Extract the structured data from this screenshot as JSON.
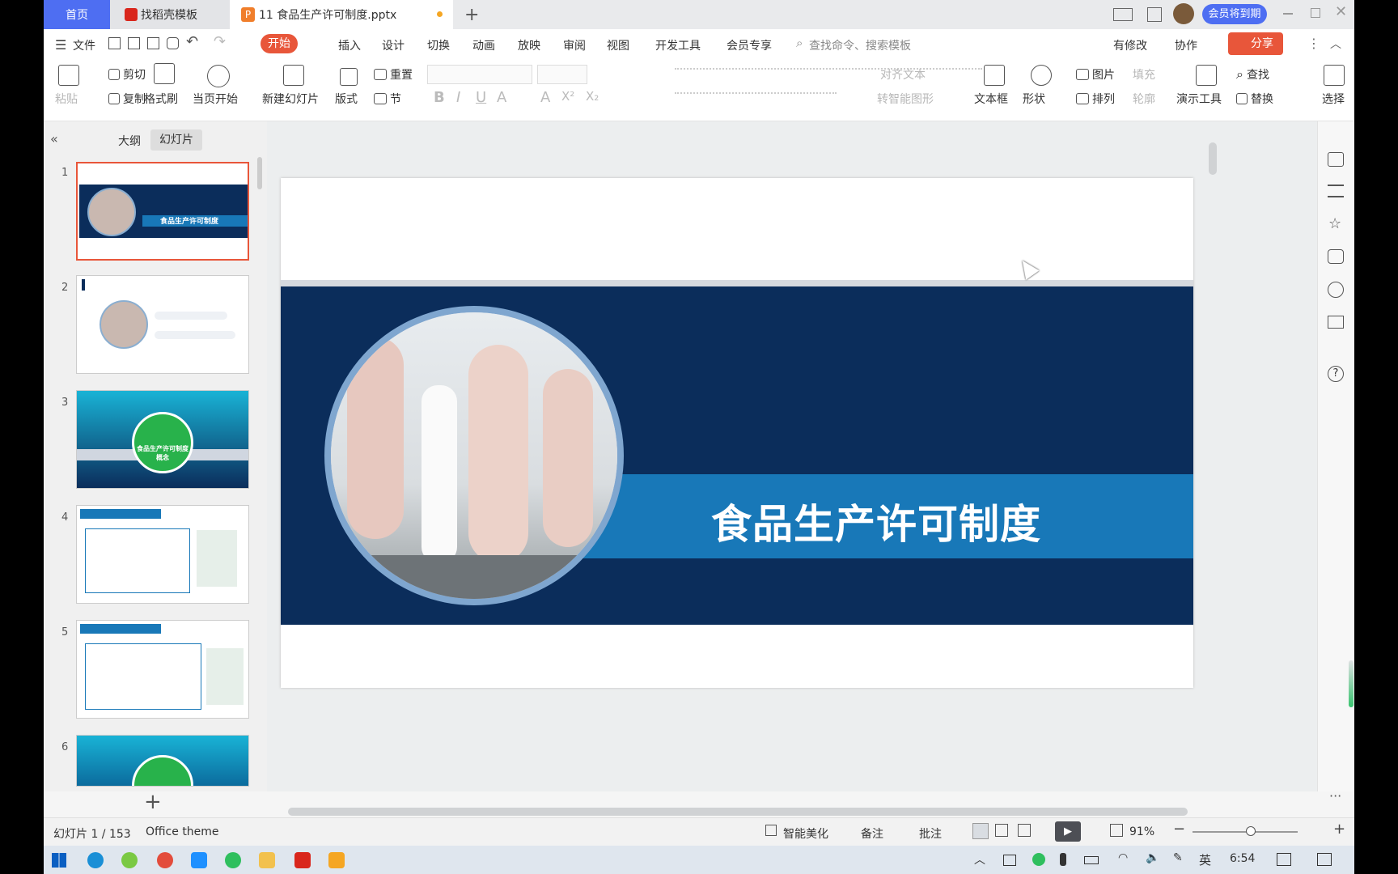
{
  "tabs": {
    "home": "首页",
    "template": "找稻壳模板",
    "doc": "11 食品生产许可制度.pptx",
    "member": "会员将到期"
  },
  "menu": {
    "file": "文件",
    "items": [
      "开始",
      "插入",
      "设计",
      "切换",
      "动画",
      "放映",
      "审阅",
      "视图",
      "开发工具",
      "会员专享"
    ],
    "search": "查找命令、搜索模板",
    "modified": "有修改",
    "collab": "协作",
    "share": "分享"
  },
  "ribbon": {
    "paste": "粘贴",
    "cut": "剪切",
    "copy": "复制",
    "format_painter": "格式刷",
    "play_from_current": "当页开始",
    "new_slide": "新建幻灯片",
    "layout": "版式",
    "section": "节",
    "reset": "重置",
    "align_text": "对齐文本",
    "smart_art": "转智能图形",
    "textbox": "文本框",
    "shape": "形状",
    "picture": "图片",
    "fill": "填充",
    "arrange": "排列",
    "outline": "轮廓",
    "present_tools": "演示工具",
    "find": "查找",
    "replace": "替换",
    "select": "选择"
  },
  "panel": {
    "outline_tab": "大纲",
    "slides_tab": "幻灯片",
    "slide_numbers": [
      "1",
      "2",
      "3",
      "4",
      "5",
      "6"
    ],
    "thumb1_title": "食品生产许可制度",
    "thumb3_title": "食品生产许可制度概念"
  },
  "slide": {
    "title": "食品生产许可制度"
  },
  "status": {
    "slide_info": "幻灯片 1 / 153",
    "theme": "Office theme",
    "beautify": "智能美化",
    "notes": "备注",
    "comment": "批注",
    "zoom": "91%"
  },
  "taskbar": {
    "ime": "英",
    "time": "6:54"
  },
  "colors": {
    "accent": "#e8563a",
    "home_tab": "#4e6ef2",
    "slide_navy": "#0b2d5b",
    "slide_band": "#1878b8"
  }
}
